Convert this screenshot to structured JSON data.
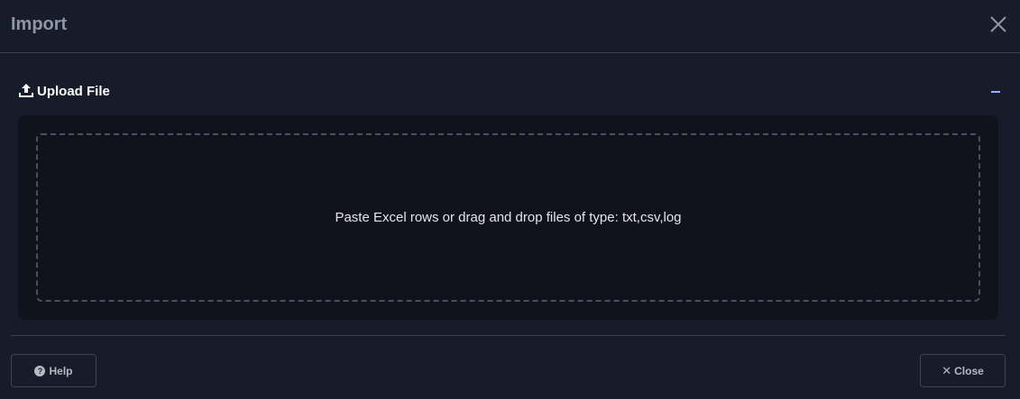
{
  "dialog": {
    "title": "Import",
    "close_icon": "close-icon"
  },
  "section": {
    "icon": "upload-icon",
    "title": "Upload File",
    "collapse_icon": "minus-icon"
  },
  "dropzone": {
    "text": "Paste Excel rows or drag and drop files of type: txt,csv,log"
  },
  "footer": {
    "help_label": "Help",
    "help_icon": "question-circle-icon",
    "close_label": "Close",
    "close_icon": "x-icon"
  },
  "colors": {
    "background": "#171c2a",
    "panel": "#10131c",
    "accent": "#8fb2ff"
  }
}
